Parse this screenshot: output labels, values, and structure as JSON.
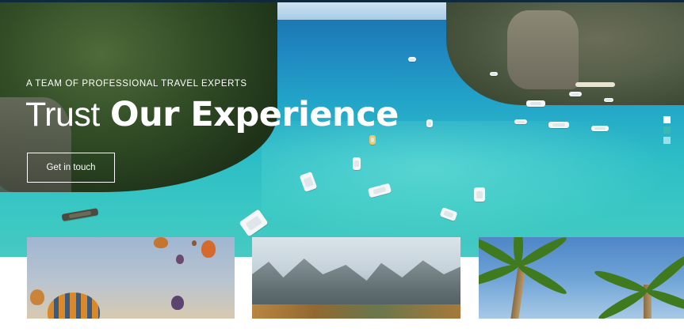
{
  "hero": {
    "tagline": "A TEAM OF PROFESSIONAL TRAVEL EXPERTS",
    "headline_light": "Trust",
    "headline_bold": "Our Experience",
    "cta_label": "Get in touch"
  },
  "slider": {
    "dots": [
      "slide-1",
      "slide-2",
      "slide-3"
    ],
    "active_index": 0
  },
  "cards": [
    {
      "name": "hot-air-balloons"
    },
    {
      "name": "mountain-peaks"
    },
    {
      "name": "palm-trees"
    }
  ],
  "colors": {
    "text": "#ffffff",
    "water": "#2cbcc6",
    "dark": "#0f2a3a"
  }
}
